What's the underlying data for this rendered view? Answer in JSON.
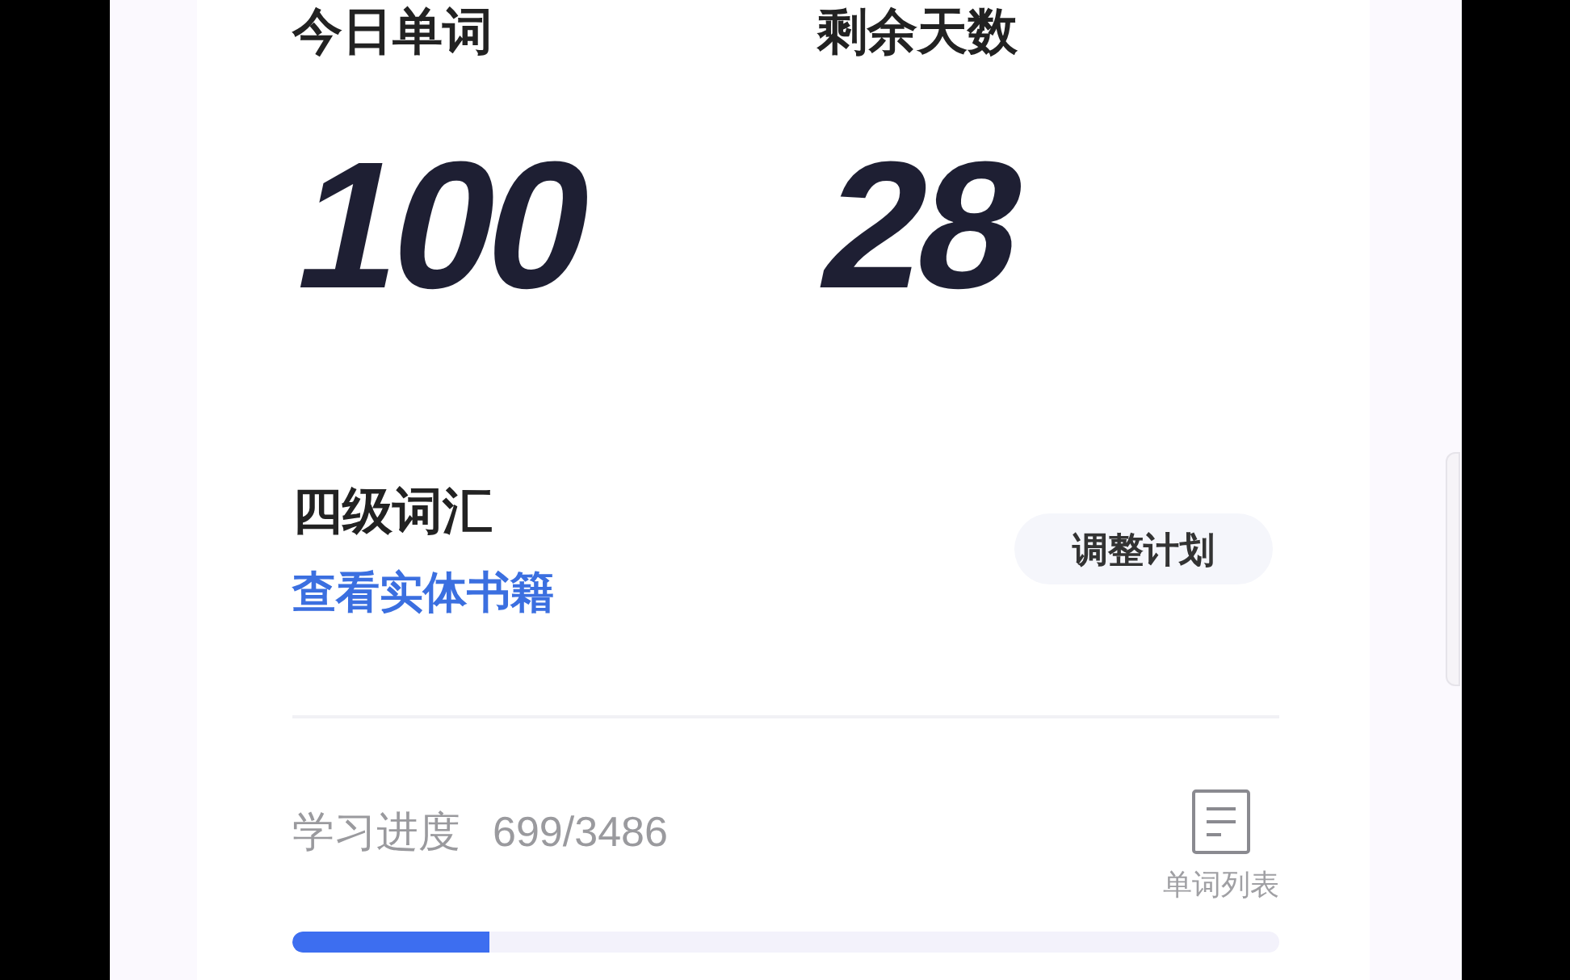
{
  "stats": [
    {
      "label": "今日单词",
      "value": "100"
    },
    {
      "label": "剩余天数",
      "value": "28"
    }
  ],
  "book": {
    "title": "四级词汇",
    "link": "查看实体书籍",
    "button": "调整计划"
  },
  "progress": {
    "label": "学习进度",
    "count": "699/3486",
    "level": 0.2,
    "word_list": "单词列表"
  }
}
